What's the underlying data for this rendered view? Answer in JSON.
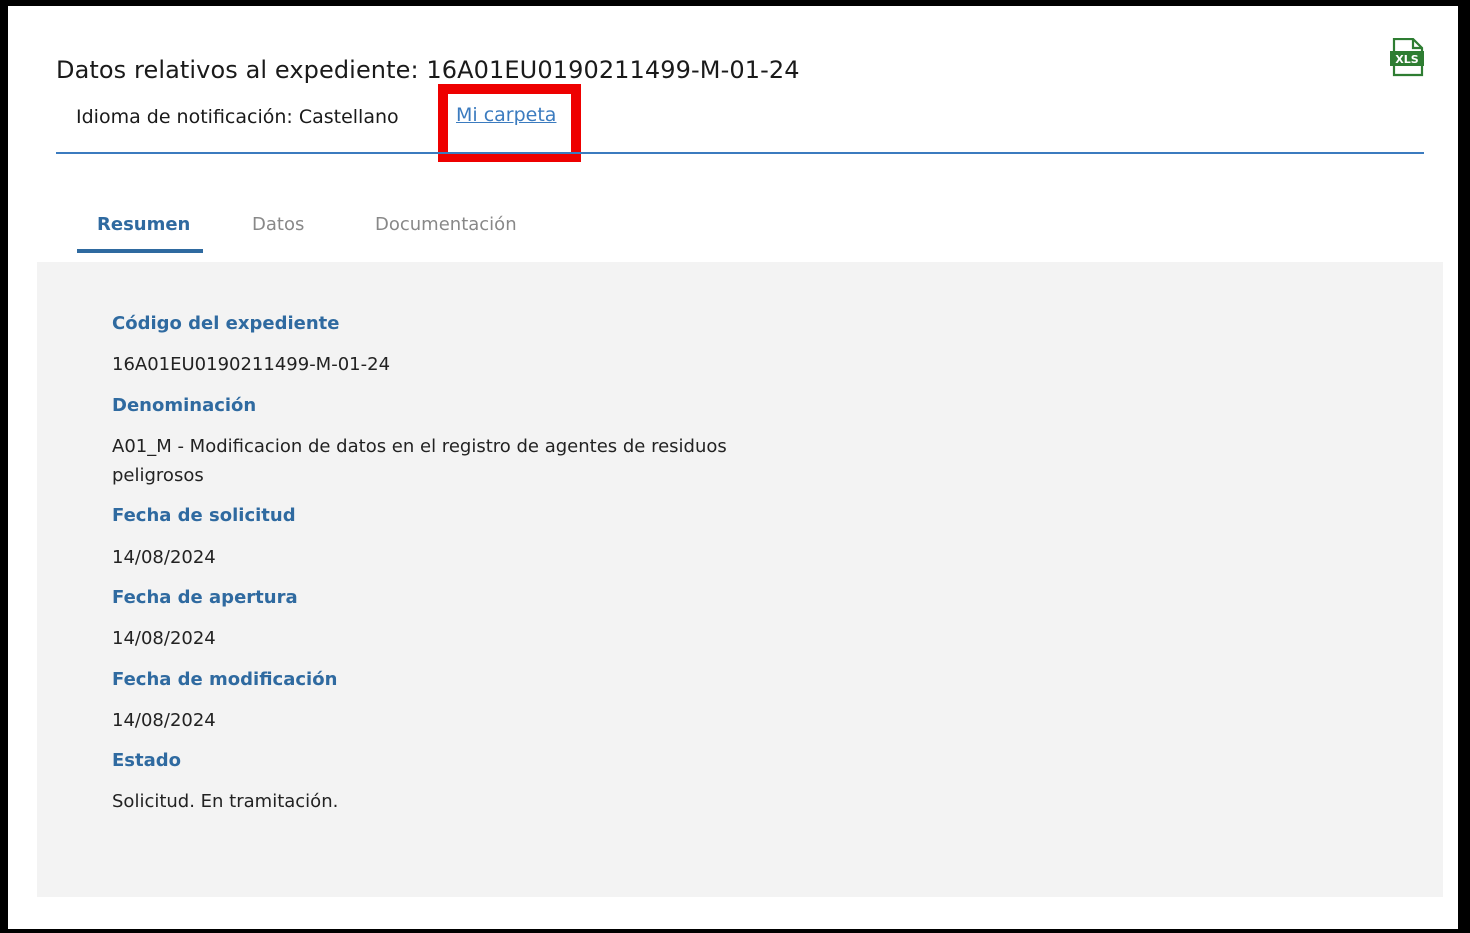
{
  "header": {
    "title": "Datos relativos al expediente: 16A01EU0190211499-M-01-24",
    "notification_language": "Idioma de notificación: Castellano",
    "folder_link": "Mi carpeta",
    "export_icon": "xls-file-icon",
    "export_icon_text": "XLS"
  },
  "tabs": [
    {
      "label": "Resumen",
      "active": true
    },
    {
      "label": "Datos",
      "active": false
    },
    {
      "label": "Documentación",
      "active": false
    }
  ],
  "summary": {
    "fields": [
      {
        "label": "Código del expediente",
        "value": "16A01EU0190211499-M-01-24"
      },
      {
        "label": "Denominación",
        "value": "A01_M - Modificacion de datos en el registro de agentes de residuos peligrosos"
      },
      {
        "label": "Fecha de solicitud",
        "value": "14/08/2024"
      },
      {
        "label": "Fecha de apertura",
        "value": "14/08/2024"
      },
      {
        "label": "Fecha de modificación",
        "value": "14/08/2024"
      },
      {
        "label": "Estado",
        "value": "Solicitud. En tramitación."
      }
    ]
  },
  "colors": {
    "accent": "#2f6aa0",
    "link": "#3b7bbf",
    "highlight": "#ee0000",
    "panel_bg": "#f3f3f3",
    "xls_green": "#2e7d32"
  }
}
